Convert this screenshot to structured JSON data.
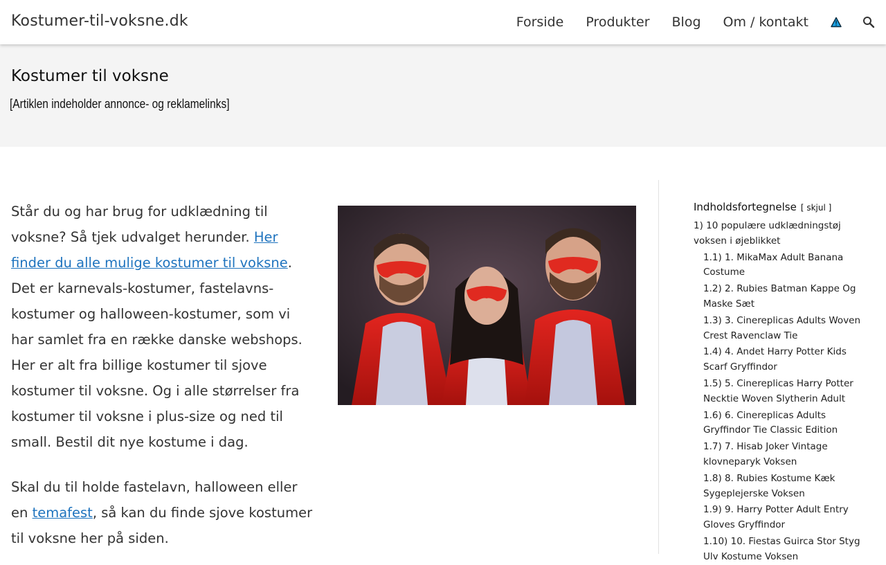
{
  "site": {
    "logo": "Kostumer-til-voksne.dk"
  },
  "nav": {
    "items": [
      "Forside",
      "Produkter",
      "Blog",
      "Om / kontakt"
    ],
    "accent_color": "#1ba1e2"
  },
  "page": {
    "title": "Kostumer til voksne",
    "disclaimer": "[Artiklen indeholder annonce- og reklamelinks]"
  },
  "content": {
    "p1_start": "Står du og har brug for udklædning til voksne? Så tjek udvalget herunder. ",
    "p1_link": "Her finder du alle mulige kostumer til voksne",
    "p1_end": ". Det er karnevals-kostumer, fastelavns-kostumer og halloween-kostumer, som vi har samlet fra en række danske webshops. Her er alt fra billige kostumer til sjove kostumer til voksne. Og i alle størrelser fra kostumer til voksne i plus-size og ned til small. Bestil dit nye kostume i dag.",
    "p2_start": "Skal du til holde fastelavn, halloween eller en ",
    "p2_link": "temafest",
    "p2_end": ", så kan du finde sjove kostumer til voksne her på siden.",
    "link_color": "#1e73be"
  },
  "image": {
    "subject": "three adults in red masks and red capes"
  },
  "toc": {
    "heading": "Indholdsfortegnelse",
    "toggle": "[ skjul ]",
    "main_item": "1) 10 populære udklædningstøj voksen i øjeblikket",
    "sub_items": [
      "1.1) 1. MikaMax Adult Banana Costume",
      "1.2) 2. Rubies Batman Kappe Og Maske Sæt",
      "1.3) 3. Cinereplicas Adults Woven Crest Ravenclaw Tie",
      "1.4) 4. Andet Harry Potter Kids Scarf Gryffindor",
      "1.5) 5. Cinereplicas Harry Potter Necktie Woven Slytherin Adult",
      "1.6) 6. Cinereplicas Adults Gryffindor Tie Classic Edition",
      "1.7) 7. Hisab Joker Vintage klovneparyk Voksen",
      "1.8) 8. Rubies Kostume Kæk Sygeplejerske Voksen",
      "1.9) 9. Harry Potter Adult Entry Gloves Gryffindor",
      "1.10) 10. Fiestas Guirca Stor Styg Ulv Kostume Voksen"
    ]
  }
}
